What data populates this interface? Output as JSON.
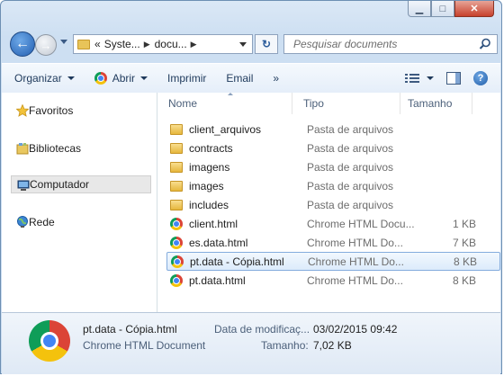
{
  "window": {
    "caption_buttons": {
      "minimize": "▁",
      "maximize": "□",
      "close": "✕"
    }
  },
  "address": {
    "overflow": "«",
    "crumbs": [
      "Syste...",
      "docu..."
    ]
  },
  "search": {
    "placeholder": "Pesquisar documents"
  },
  "toolbar": {
    "organize": "Organizar",
    "open": "Abrir",
    "print": "Imprimir",
    "email": "Email",
    "more": "»"
  },
  "sidebar": {
    "items": [
      {
        "label": "Favoritos",
        "icon": "star-icon"
      },
      {
        "label": "Bibliotecas",
        "icon": "libraries-icon"
      },
      {
        "label": "Computador",
        "icon": "computer-icon",
        "selected": true
      },
      {
        "label": "Rede",
        "icon": "network-icon"
      }
    ]
  },
  "columns": {
    "name": "Nome",
    "type": "Tipo",
    "size": "Tamanho"
  },
  "files": [
    {
      "name": "client_arquivos",
      "type": "Pasta de arquivos",
      "size": "",
      "icon": "folder-icon"
    },
    {
      "name": "contracts",
      "type": "Pasta de arquivos",
      "size": "",
      "icon": "folder-icon"
    },
    {
      "name": "imagens",
      "type": "Pasta de arquivos",
      "size": "",
      "icon": "folder-icon"
    },
    {
      "name": "images",
      "type": "Pasta de arquivos",
      "size": "",
      "icon": "folder-icon"
    },
    {
      "name": "includes",
      "type": "Pasta de arquivos",
      "size": "",
      "icon": "folder-icon"
    },
    {
      "name": "client.html",
      "type": "Chrome HTML Docu...",
      "size": "1 KB",
      "icon": "chrome-icon"
    },
    {
      "name": "es.data.html",
      "type": "Chrome HTML Do...",
      "size": "7 KB",
      "icon": "chrome-icon"
    },
    {
      "name": "pt.data - Cópia.html",
      "type": "Chrome HTML Do...",
      "size": "8 KB",
      "icon": "chrome-icon",
      "selected": true
    },
    {
      "name": "pt.data.html",
      "type": "Chrome HTML Do...",
      "size": "8 KB",
      "icon": "chrome-icon"
    }
  ],
  "details": {
    "name": "pt.data - Cópia.html",
    "type": "Chrome HTML Document",
    "modified_label": "Data de modificaç...",
    "modified_value": "03/02/2015 09:42",
    "size_label": "Tamanho:",
    "size_value": "7,02 KB"
  }
}
